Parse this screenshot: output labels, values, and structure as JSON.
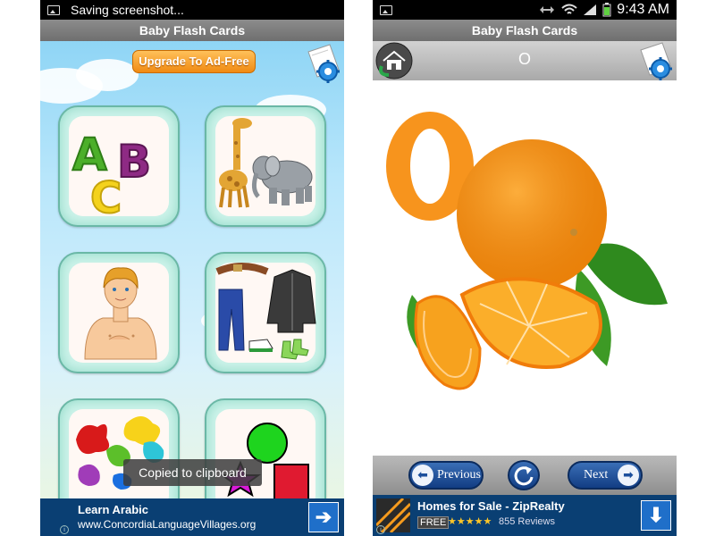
{
  "left_screen": {
    "status_bar": {
      "notification": "Saving screenshot..."
    },
    "title": "Baby Flash Cards",
    "upgrade_button": "Upgrade To Ad-Free",
    "toast": "Copied to clipboard",
    "ad": {
      "title": "Learn Arabic",
      "url": "www.ConcordiaLanguageVillages.org"
    }
  },
  "right_screen": {
    "status_bar": {
      "time": "9:43 AM"
    },
    "title": "Baby Flash Cards",
    "current_letter": "O",
    "buttons": {
      "previous": "Previous",
      "next": "Next"
    },
    "ad": {
      "title": "Homes for Sale - ZipRealty",
      "badge": "FREE",
      "rating_stars": "★★★★★",
      "reviews": "855 Reviews"
    }
  },
  "colors": {
    "accent_orange": "#f7941d",
    "nav_blue": "#1b4e98",
    "ad_navy": "#0a3f73",
    "tile_mint": "#cdf3ea"
  }
}
